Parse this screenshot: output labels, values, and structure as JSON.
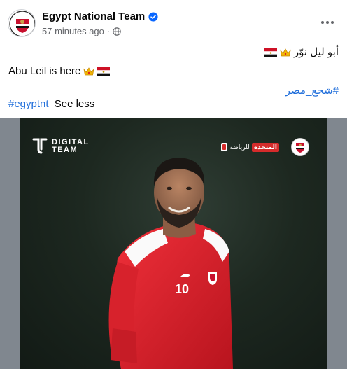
{
  "post": {
    "page_name": "Egypt National Team",
    "timestamp": "57 minutes ago",
    "separator": "·",
    "text_ar": "أبو ليل نوّر",
    "text_en": "Abu Leil is here",
    "hashtag_ar": "#شجع_مصر",
    "hashtag_en": "#egyptnt",
    "see_less": "See less"
  },
  "image": {
    "logo_line1": "DIGITAL",
    "logo_line2": "TEAM",
    "sponsor_text": "للرياضة",
    "sponsor_brand": "المتحدة",
    "jersey_number": "10"
  },
  "icons": {
    "verified": "verified-badge-icon",
    "audience": "globe-icon",
    "more": "more-options-icon",
    "crown": "crown-emoji",
    "flag": "egypt-flag-emoji"
  },
  "colors": {
    "link": "#216fdb",
    "verified": "#0866ff",
    "secondary_text": "#65676b",
    "jersey_red": "#e3202b"
  }
}
